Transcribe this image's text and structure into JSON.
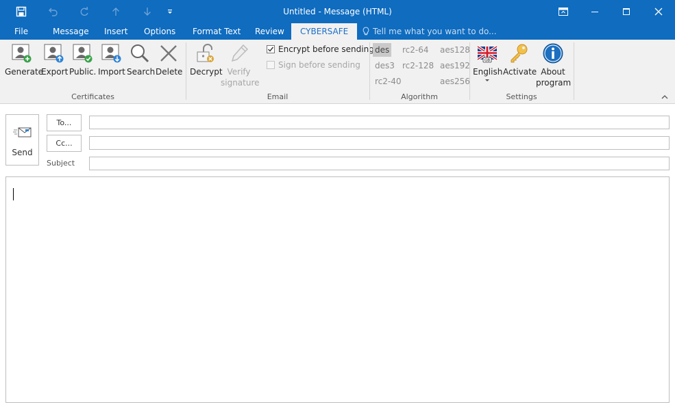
{
  "window": {
    "title": "Untitled  -  Message (HTML)"
  },
  "quick_access": {
    "icons": [
      "save-icon",
      "undo-icon",
      "redo-icon",
      "up-arrow-icon",
      "down-arrow-icon",
      "customize-icon"
    ]
  },
  "tabs": [
    {
      "label": "File"
    },
    {
      "label": "Message"
    },
    {
      "label": "Insert"
    },
    {
      "label": "Options"
    },
    {
      "label": "Format Text"
    },
    {
      "label": "Review"
    },
    {
      "label": "CYBERSAFE"
    }
  ],
  "tellme": {
    "label": "Tell me what you want to do..."
  },
  "ribbon": {
    "certificates": {
      "label": "Certificates",
      "generate": "Generate",
      "export": "Export",
      "publicize": "Public.",
      "import": "Import",
      "search": "Search",
      "delete": "Delete"
    },
    "email": {
      "label": "Email",
      "decrypt": "Decrypt",
      "verify_line1": "Verify",
      "verify_line2": "signature",
      "encrypt_before_sending": "Encrypt before sending",
      "sign_before_sending": "Sign before sending"
    },
    "algorithm": {
      "label": "Algorithm",
      "options": [
        "des",
        "rc2-64",
        "aes128",
        "des3",
        "rc2-128",
        "aes192",
        "rc2-40",
        "aes256"
      ],
      "selected": "des"
    },
    "settings": {
      "label": "Settings",
      "language": "English",
      "activate": "Activate",
      "about_line1": "About",
      "about_line2": "program"
    }
  },
  "compose": {
    "send": "Send",
    "to": "To...",
    "cc": "Cc...",
    "subject": "Subject",
    "to_value": "",
    "cc_value": "",
    "subject_value": ""
  },
  "colors": {
    "title_bar": "#0f6cbf",
    "ribbon_bg": "#f1f1f1",
    "active_tab_text": "#1c6ec7"
  }
}
